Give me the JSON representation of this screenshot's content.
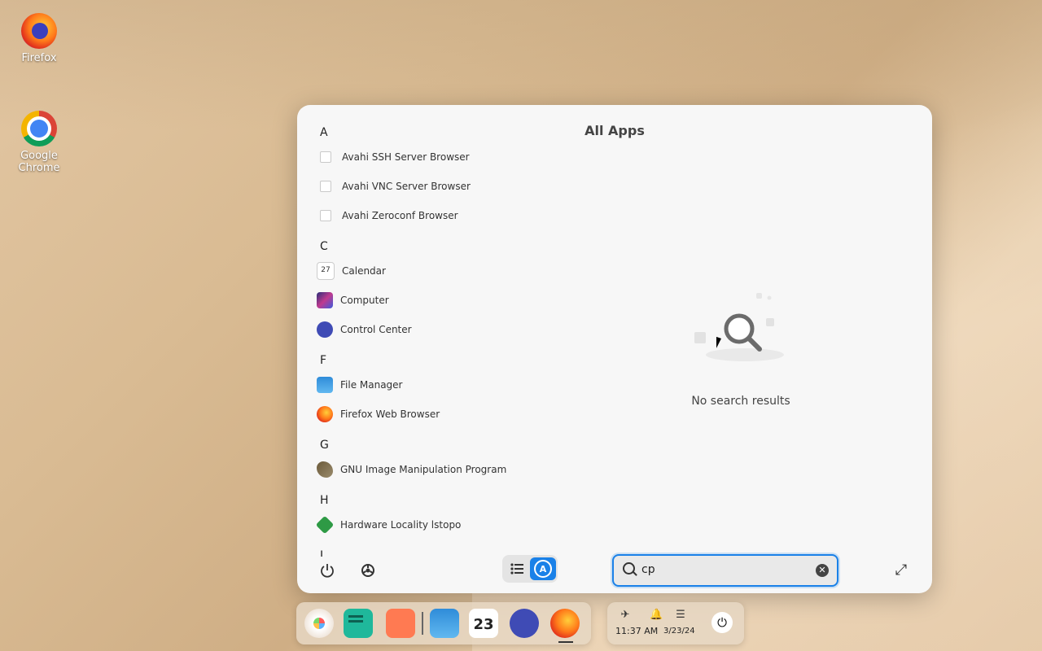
{
  "desktop": {
    "icons": [
      {
        "label": "Firefox",
        "icon": "firefox-icon"
      },
      {
        "label": "Google Chrome",
        "icon": "chrome-icon"
      }
    ]
  },
  "launcher": {
    "title": "All Apps",
    "groups": [
      {
        "letter": "A",
        "apps": [
          {
            "label": "Avahi SSH Server Browser",
            "icon": "avahi-icon"
          },
          {
            "label": "Avahi VNC Server Browser",
            "icon": "avahi-icon"
          },
          {
            "label": "Avahi Zeroconf Browser",
            "icon": "avahi-icon"
          }
        ]
      },
      {
        "letter": "C",
        "apps": [
          {
            "label": "Calendar",
            "icon": "calendar-icon",
            "badge": "27"
          },
          {
            "label": "Computer",
            "icon": "computer-icon"
          },
          {
            "label": "Control Center",
            "icon": "control-center-icon"
          }
        ]
      },
      {
        "letter": "F",
        "apps": [
          {
            "label": "File Manager",
            "icon": "file-manager-icon"
          },
          {
            "label": "Firefox Web Browser",
            "icon": "firefox-icon"
          }
        ]
      },
      {
        "letter": "G",
        "apps": [
          {
            "label": "GNU Image Manipulation Program",
            "icon": "gimp-icon"
          }
        ]
      },
      {
        "letter": "H",
        "apps": [
          {
            "label": "Hardware Locality lstopo",
            "icon": "hwloc-icon"
          }
        ]
      },
      {
        "letter": "I",
        "apps": []
      }
    ],
    "empty_message": "No search results",
    "search": {
      "value": "cp",
      "placeholder": ""
    },
    "view_toggle": {
      "list_icon": "list-view-icon",
      "category_icon": "category-view-icon",
      "category_glyph": "A",
      "active": "category"
    }
  },
  "dock": {
    "calendar_day": "23",
    "items": [
      "launcher-icon",
      "terminal-icon",
      "multitasking-icon",
      "file-manager-icon",
      "calendar-icon",
      "control-center-icon",
      "firefox-icon"
    ]
  },
  "tray": {
    "time": "11:37 AM",
    "date": "3/23/24"
  },
  "colors": {
    "accent": "#1a81e8"
  }
}
